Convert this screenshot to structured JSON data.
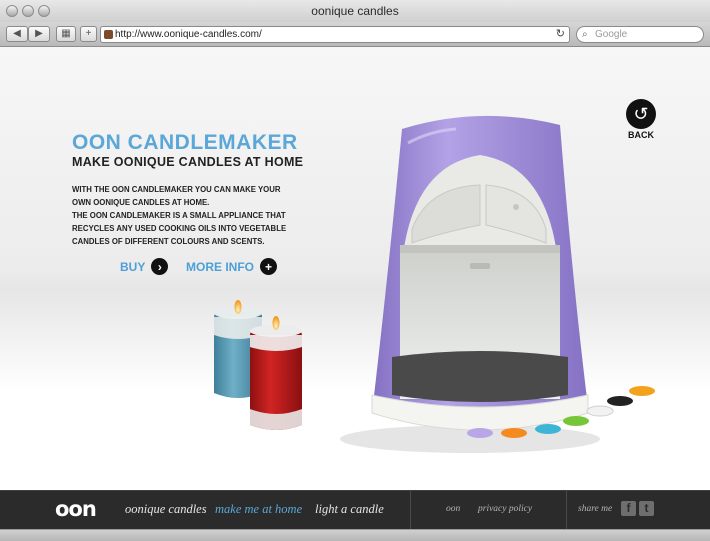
{
  "browser": {
    "window_title": "oonique candles",
    "url": "http://www.oonique-candles.com/",
    "search_placeholder": "Google"
  },
  "hero": {
    "title": "OON CANDLEMAKER",
    "subtitle": "MAKE OONIQUE CANDLES AT HOME",
    "description_lines": [
      "WITH THE OON CANDLEMAKER YOU CAN MAKE YOUR",
      "OWN OONIQUE CANDLES AT HOME.",
      "THE OON CANDLEMAKER IS A SMALL APPLIANCE THAT",
      "RECYCLES ANY USED COOKING OILS INTO VEGETABLE",
      "CANDLES OF DIFFERENT COLOURS AND SCENTS."
    ],
    "buy_label": "BUY",
    "more_info_label": "MORE INFO",
    "back_label": "BACK"
  },
  "footer": {
    "logo": "oon",
    "nav": [
      "oonique candles",
      "make me at home",
      "light a candle"
    ],
    "active_index": 1,
    "oon_link": "oon",
    "privacy_link": "privacy policy",
    "share_label": "share me",
    "social": [
      "facebook",
      "twitter"
    ]
  },
  "colors": {
    "accent": "#5aa7d8",
    "device_purple": "#9b86cf",
    "footer_bg": "#2b2b2b"
  },
  "color_chips": [
    "#b9a6e6",
    "#f58a1f",
    "#3fb5d6",
    "#77c63a",
    "#f2f2f2",
    "#222222",
    "#f2a21b"
  ]
}
